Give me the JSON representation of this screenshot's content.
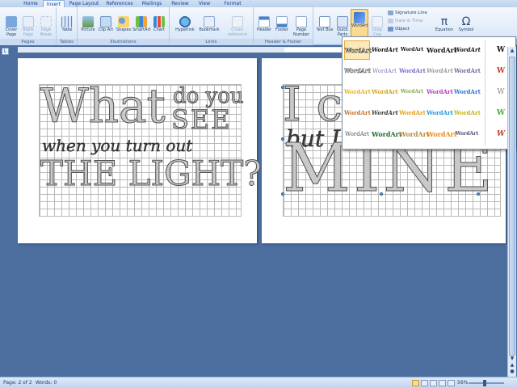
{
  "tabs": [
    "Home",
    "Insert",
    "Page Layout",
    "References",
    "Mailings",
    "Review",
    "View",
    "Format"
  ],
  "active_tab": "Insert",
  "groups": {
    "pages": {
      "label": "Pages",
      "buttons": [
        "Cover Page",
        "Blank Page",
        "Page Break"
      ]
    },
    "tables": {
      "label": "Tables",
      "buttons": [
        "Table"
      ]
    },
    "illustrations": {
      "label": "Illustrations",
      "buttons": [
        "Picture",
        "Clip Art",
        "Shapes",
        "SmartArt",
        "Chart"
      ]
    },
    "links": {
      "label": "Links",
      "buttons": [
        "Hyperlink",
        "Bookmark",
        "Cross-reference"
      ]
    },
    "header_footer": {
      "label": "Header & Footer",
      "buttons": [
        "Header",
        "Footer",
        "Page Number"
      ]
    },
    "text": {
      "buttons": [
        "Text Box",
        "Quick Parts",
        "WordArt",
        "Drop Cap"
      ],
      "small": [
        "Signature Line",
        "Date & Time",
        "Object"
      ]
    },
    "symbols": {
      "buttons": [
        "Equation",
        "Symbol"
      ]
    }
  },
  "page1": {
    "line1_big": "What",
    "line1_small": "do you",
    "line2": "SEE",
    "line3": "when you turn out",
    "line4": "THE LIGHT?"
  },
  "page2": {
    "line1": "I can",
    "line2": "but I",
    "line3": "MINE"
  },
  "gallery": {
    "item_text": "WordArt",
    "side_text": "W"
  },
  "status": {
    "page": "Page: 2 of 2",
    "words": "Words: 0",
    "zoom": "56%"
  },
  "colors": {
    "ribbon_bg": "#dbe8f8",
    "workspace_bg": "#4b6e9e",
    "accent": "#15428b"
  }
}
